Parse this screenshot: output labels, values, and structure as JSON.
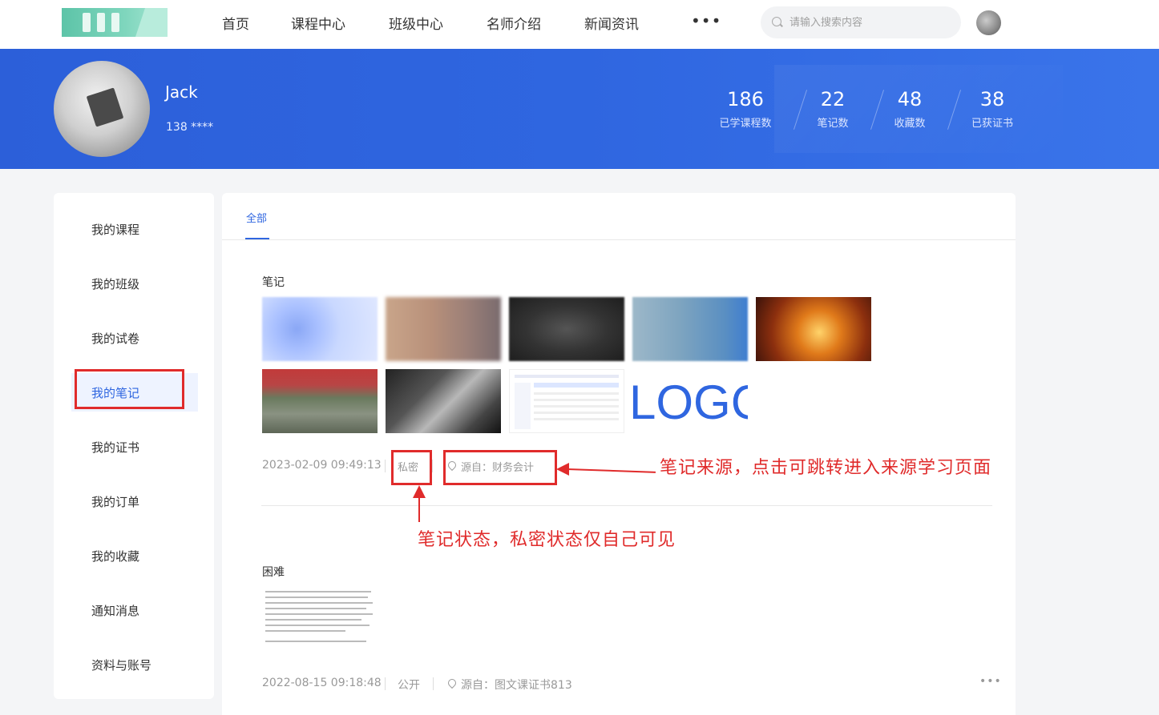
{
  "nav": {
    "items": [
      "首页",
      "课程中心",
      "班级中心",
      "名师介绍",
      "新闻资讯"
    ],
    "more": "•••",
    "search_placeholder": "请输入搜索内容"
  },
  "profile": {
    "name": "Jack",
    "phone": "138 ****",
    "stats": [
      {
        "value": "186",
        "label": "已学课程数"
      },
      {
        "value": "22",
        "label": "笔记数"
      },
      {
        "value": "48",
        "label": "收藏数"
      },
      {
        "value": "38",
        "label": "已获证书"
      }
    ]
  },
  "sidebar": {
    "items": [
      "我的课程",
      "我的班级",
      "我的试卷",
      "我的笔记",
      "我的证书",
      "我的订单",
      "我的收藏",
      "通知消息",
      "资料与账号"
    ],
    "active_index": 3
  },
  "tabs": {
    "all": "全部"
  },
  "notes": [
    {
      "title": "笔记",
      "time": "2023-02-09 09:49:13",
      "status": "私密",
      "source": "源自：财务会计",
      "logo_text": "LOGC"
    },
    {
      "title": "困难",
      "time": "2022-08-15 09:18:48",
      "status": "公开",
      "source": "源自：图文课证书813",
      "more": "•••"
    }
  ],
  "annotations": {
    "source_note": "笔记来源，点击可跳转进入来源学习页面",
    "status_note": "笔记状态，私密状态仅自己可见"
  },
  "colors": {
    "primary": "#2f66e0",
    "annotation": "#e02b2b"
  }
}
